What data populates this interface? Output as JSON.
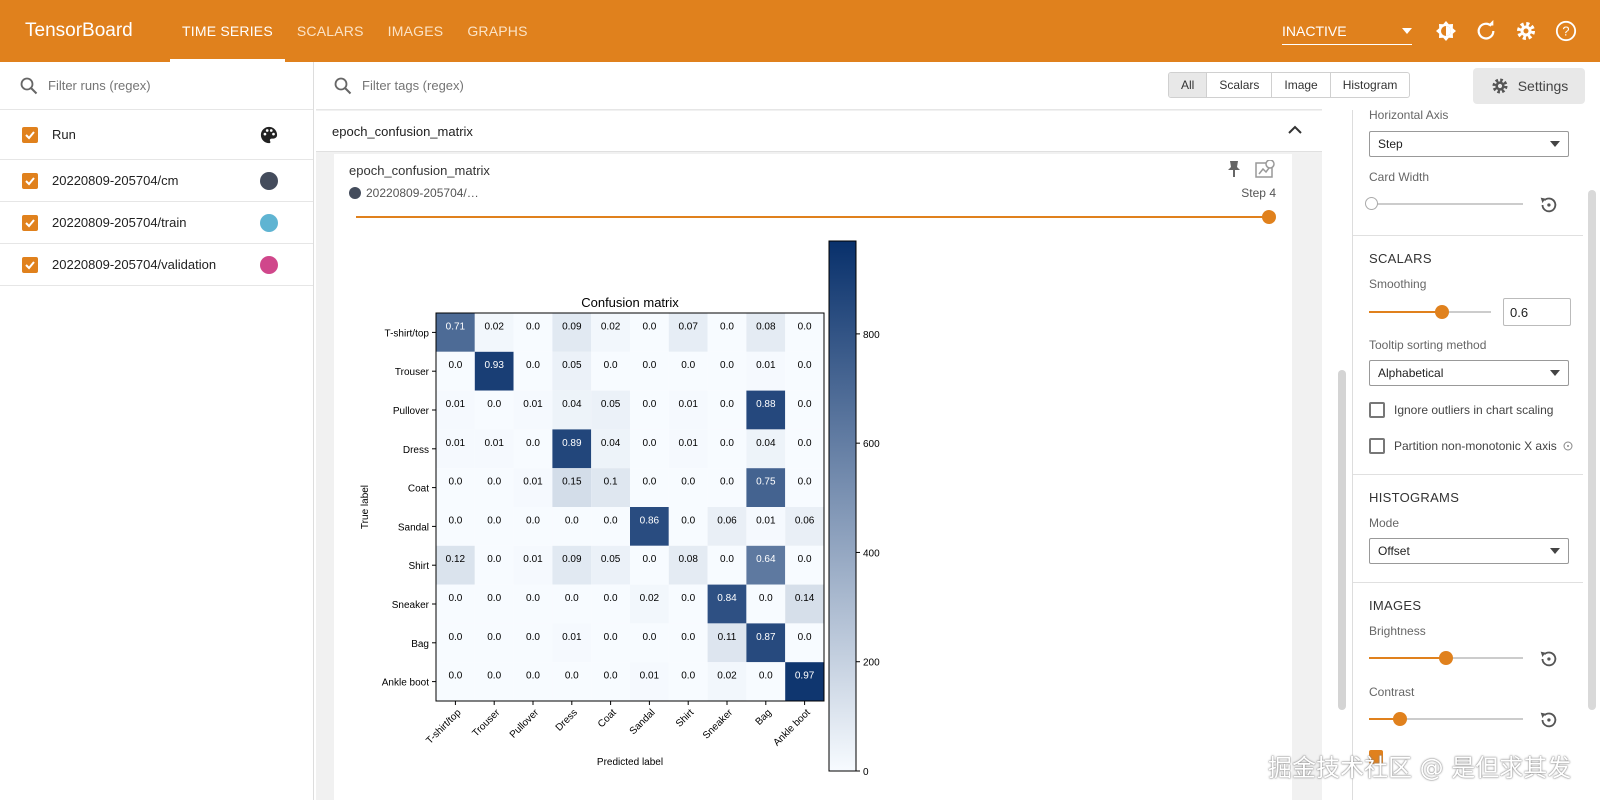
{
  "header": {
    "brand": "TensorBoard",
    "tabs": [
      "TIME SERIES",
      "SCALARS",
      "IMAGES",
      "GRAPHS"
    ],
    "active_tab": "TIME SERIES",
    "status": "INACTIVE",
    "accent": "#e0811d"
  },
  "runs_panel": {
    "filter_placeholder": "Filter runs (regex)",
    "header_label": "Run",
    "runs": [
      {
        "name": "20220809-205704/cm",
        "color": "#444c5c"
      },
      {
        "name": "20220809-205704/train",
        "color": "#5fb4d2"
      },
      {
        "name": "20220809-205704/validation",
        "color": "#d0478b"
      }
    ]
  },
  "main": {
    "filter_placeholder": "Filter tags (regex)",
    "type_buttons": [
      "All",
      "Scalars",
      "Image",
      "Histogram"
    ],
    "settings_label": "Settings",
    "group_title": "epoch_confusion_matrix",
    "card": {
      "title": "epoch_confusion_matrix",
      "run": "20220809-205704/…",
      "step": "Step 4"
    }
  },
  "settings": {
    "horizontal_axis_label": "Horizontal Axis",
    "horizontal_axis_value": "Step",
    "card_width_label": "Card Width",
    "scalars_title": "SCALARS",
    "smoothing_label": "Smoothing",
    "smoothing_value": "0.6",
    "tooltip_label": "Tooltip sorting method",
    "tooltip_value": "Alphabetical",
    "ignore_outliers": "Ignore outliers in chart scaling",
    "partition": "Partition non-monotonic X axis",
    "histograms_title": "HISTOGRAMS",
    "mode_label": "Mode",
    "mode_value": "Offset",
    "images_title": "IMAGES",
    "brightness_label": "Brightness",
    "contrast_label": "Contrast"
  },
  "watermark": "掘金技术社区 @ 是但求其发",
  "chart_data": {
    "type": "heatmap",
    "title": "Confusion matrix",
    "xlabel": "Predicted label",
    "ylabel": "True label",
    "labels": [
      "T-shirt/top",
      "Trouser",
      "Pullover",
      "Dress",
      "Coat",
      "Sandal",
      "Shirt",
      "Sneaker",
      "Bag",
      "Ankle boot"
    ],
    "matrix": [
      [
        0.71,
        0.02,
        0.0,
        0.09,
        0.02,
        0.0,
        0.07,
        0.0,
        0.08,
        0.0
      ],
      [
        0.0,
        0.93,
        0.0,
        0.05,
        0.0,
        0.0,
        0.0,
        0.0,
        0.01,
        0.0
      ],
      [
        0.01,
        0.0,
        0.01,
        0.04,
        0.05,
        0.0,
        0.01,
        0.0,
        0.88,
        0.0
      ],
      [
        0.01,
        0.01,
        0.0,
        0.89,
        0.04,
        0.0,
        0.01,
        0.0,
        0.04,
        0.0
      ],
      [
        0.0,
        0.0,
        0.01,
        0.15,
        0.1,
        0.0,
        0.0,
        0.0,
        0.75,
        0.0
      ],
      [
        0.0,
        0.0,
        0.0,
        0.0,
        0.0,
        0.86,
        0.0,
        0.06,
        0.01,
        0.06
      ],
      [
        0.12,
        0.0,
        0.01,
        0.09,
        0.05,
        0.0,
        0.08,
        0.0,
        0.64,
        0.0
      ],
      [
        0.0,
        0.0,
        0.0,
        0.0,
        0.0,
        0.02,
        0.0,
        0.84,
        0.0,
        0.14
      ],
      [
        0.0,
        0.0,
        0.0,
        0.01,
        0.0,
        0.0,
        0.0,
        0.11,
        0.87,
        0.0
      ],
      [
        0.0,
        0.0,
        0.0,
        0.0,
        0.0,
        0.01,
        0.0,
        0.02,
        0.0,
        0.97
      ]
    ],
    "colorbar_ticks": [
      0,
      200,
      400,
      600,
      800
    ],
    "colorbar_max": 970,
    "colormap": [
      "#f7fbff",
      "#08306b"
    ]
  }
}
